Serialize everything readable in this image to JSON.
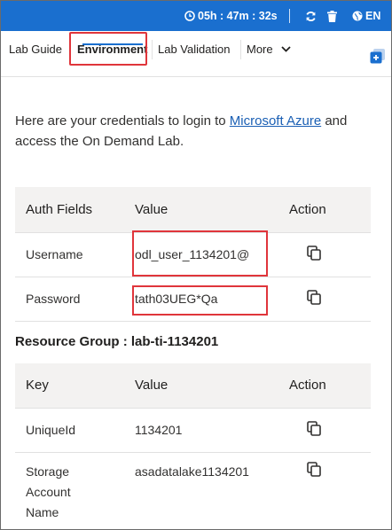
{
  "topbar": {
    "timer": "05h : 47m : 32s",
    "language": "EN",
    "icons": {
      "timer": "clock-icon",
      "refresh": "refresh-icon",
      "trash": "trash-icon",
      "language": "globe-icon"
    }
  },
  "tabs": [
    {
      "label": "Lab Guide"
    },
    {
      "label": "Environment",
      "active": true
    },
    {
      "label": "Lab Validation"
    },
    {
      "label": "More"
    }
  ],
  "intro": {
    "text_before": "Here are your credentials to login to ",
    "link": "Microsoft Azure",
    "text_after": " and access the On Demand Lab."
  },
  "credentials_table": {
    "headers": [
      "Auth Fields",
      "Value",
      "Action"
    ],
    "rows": [
      {
        "field": "Username",
        "value": "odl_user_1134201@"
      },
      {
        "field": "Password",
        "value": "tath03UEG*Qa"
      }
    ]
  },
  "resource_group": {
    "label": "Resource Group : lab-ti-1134201"
  },
  "resource_table": {
    "headers": [
      "Key",
      "Value",
      "Action"
    ],
    "rows": [
      {
        "key": "UniqueId",
        "value": "1134201"
      },
      {
        "key": "Storage Account Name",
        "value": "asadatalake1134201"
      }
    ]
  },
  "colors": {
    "topbar": "#1a6fcf",
    "highlight": "#e0353b",
    "link": "#1a5fb4",
    "table_header_bg": "#f3f2f1"
  }
}
